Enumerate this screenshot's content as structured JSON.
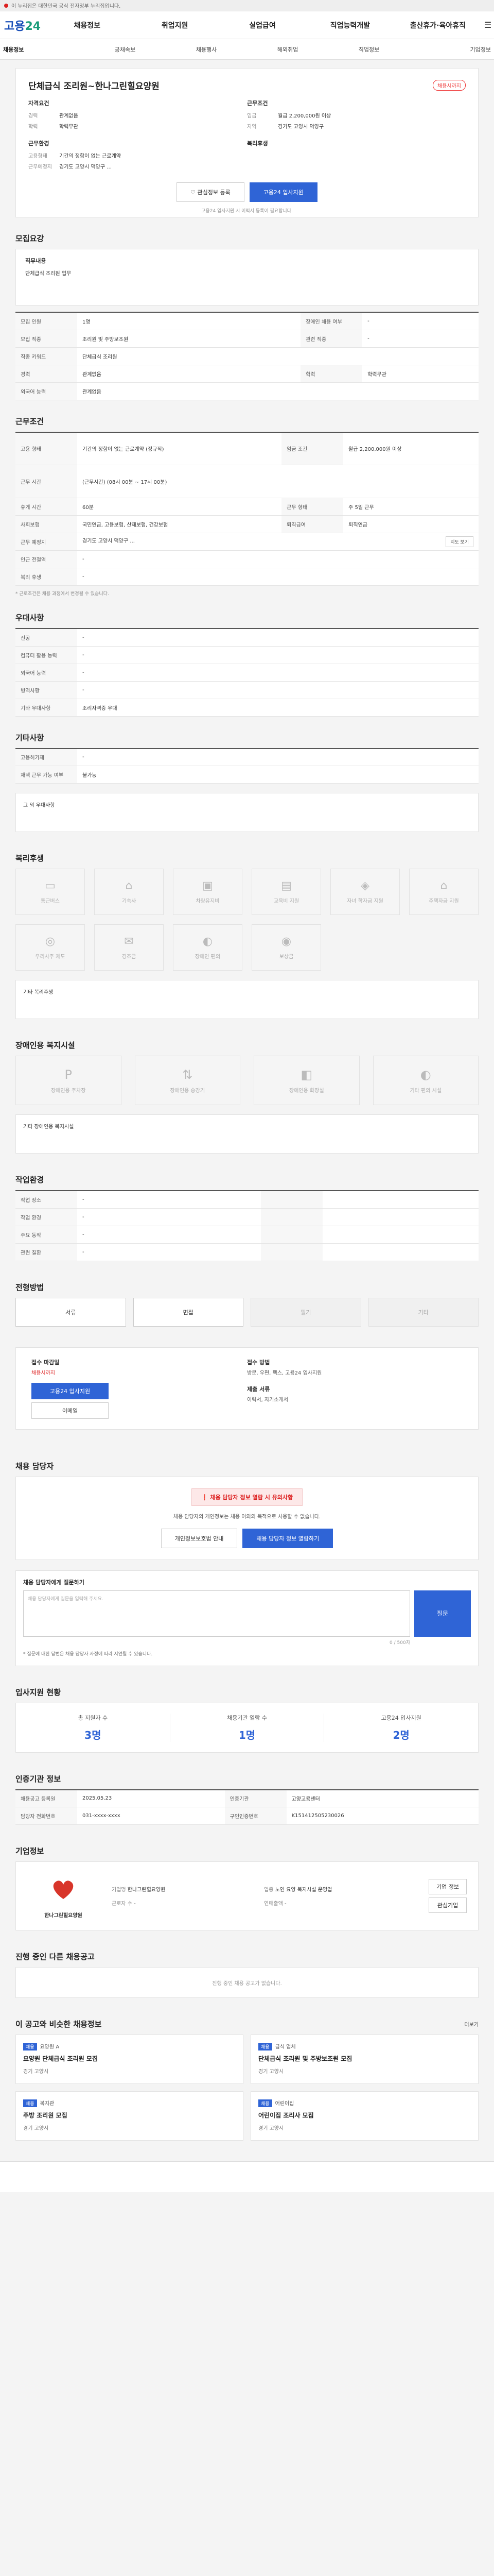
{
  "topbar": {
    "text": "이 누리집은 대한민국 공식 전자정부 누리집입니다."
  },
  "header": {
    "logo_main": "고용",
    "logo_sub": "24",
    "gnb": [
      "채용정보",
      "취업지원",
      "실업급여",
      "직업능력개발",
      "출산휴가·육아휴직"
    ]
  },
  "subnav": [
    "채용정보",
    "공채속보",
    "채용행사",
    "해외취업",
    "직업정보",
    "기업정보"
  ],
  "summary": {
    "title": "단체급식 조리원~한나그린힐요양원",
    "badge": "채용시까지",
    "left_group": "자격요건",
    "left": [
      {
        "k": "경력",
        "v": "관계없음"
      },
      {
        "k": "학력",
        "v": "학력무관"
      }
    ],
    "left_group2": "근무환경",
    "left2": [
      {
        "k": "고용형태",
        "v": "기간의 정함이 없는 근로계약"
      },
      {
        "k": "근무예정지",
        "v": "경기도 고양시 덕양구 ..."
      }
    ],
    "right_group": "근무조건",
    "right": [
      {
        "k": "임금",
        "v": "월급 2,200,000원 이상"
      },
      {
        "k": "지역",
        "v": "경기도 고양시 덕양구"
      }
    ],
    "right_group2": "복리후생",
    "btn_scrap": "관심정보 등록",
    "btn_apply": "고용24 입사지원",
    "note": "고용24 입사지원 시 이력서 등록이 필요합니다."
  },
  "recruit": {
    "title": "모집요강",
    "duty_label": "직무내용",
    "duty": "단체급식 조리원 업무",
    "rows": [
      [
        "모집 인원",
        "1명",
        "장애인 채용 여부",
        "-"
      ],
      [
        "모집 직종",
        "조리원 및 주방보조원",
        "관련 직종",
        "-"
      ],
      [
        "직종 키워드",
        "단체급식 조리원",
        "",
        ""
      ],
      [
        "경력",
        "관계없음",
        "학력",
        "학력무관"
      ],
      [
        "외국어 능력",
        "관계없음",
        "",
        ""
      ]
    ]
  },
  "work": {
    "title": "근무조건",
    "rows": [
      [
        "고용 형태",
        "기간의 정함이 없는 근로계약 (정규직)",
        "임금 조건",
        "월급 2,200,000원 이상"
      ],
      [
        "",
        "",
        "",
        ""
      ],
      [
        "근무 시간",
        "(근무시간) (08시 00분 ~ 17시 00분)",
        "",
        ""
      ],
      [
        "휴게 시간",
        "60분",
        "근무 형태",
        "주 5일 근무"
      ],
      [
        "사회보험",
        "국민연금, 고용보험, 산재보험, 건강보험",
        "퇴직급여",
        "퇴직연금"
      ],
      [
        "근무 예정지",
        "경기도 고양시 덕양구 ...",
        "",
        ""
      ],
      [
        "인근 전철역",
        "-",
        "",
        ""
      ],
      [
        "복리 후생",
        "-",
        "",
        ""
      ]
    ],
    "map_btn": "지도 보기",
    "footnote": "* 근로조건은 채용 과정에서 변경될 수 있습니다."
  },
  "prefs": {
    "title": "우대사항",
    "rows": [
      [
        "전공",
        "-"
      ],
      [
        "컴퓨터 활용 능력",
        "-"
      ],
      [
        "외국어 능력",
        "-"
      ],
      [
        "병역사항",
        "-"
      ],
      [
        "기타 우대사항",
        "조리자격증 우대"
      ]
    ]
  },
  "etc": {
    "title": "기타사항",
    "rows": [
      [
        "고용허가제",
        "-"
      ],
      [
        "재택 근무 가능 여부",
        "불가능"
      ]
    ],
    "empty": "그 외 우대사항"
  },
  "welfare": {
    "title": "복리후생",
    "items": [
      "통근버스",
      "기숙사",
      "차량유지비",
      "교육비 지원",
      "자녀 학자금 지원",
      "주택자금 지원",
      "우리사주 제도",
      "경조금",
      "장애인 편의",
      "보상금"
    ],
    "empty": "기타 복리후생"
  },
  "disab": {
    "title": "장애인용 복지시설",
    "items": [
      "장애인용 주차장",
      "장애인용 승강기",
      "장애인용 화장실",
      "기타 편의 시설"
    ],
    "empty": "기타 장애인용 복지시설"
  },
  "env": {
    "title": "작업환경",
    "rows": [
      [
        "작업 장소",
        "-",
        "",
        ""
      ],
      [
        "작업 환경",
        "-",
        "",
        ""
      ],
      [
        "주요 동작",
        "-",
        "",
        ""
      ],
      [
        "관련 질환",
        "-",
        "",
        ""
      ]
    ]
  },
  "process": {
    "title": "전형방법",
    "steps": [
      "서류",
      "면접",
      "필기",
      "기타"
    ]
  },
  "apply": {
    "label": "접수 마감일",
    "deadline": "채용시까지",
    "btn1": "고용24 입사지원",
    "btn2": "이메일",
    "label2": "접수 방법",
    "methods": "방문, 우편, 팩스, 고용24 입사지원",
    "label3": "제출 서류",
    "docs": "이력서, 자기소개서"
  },
  "contact": {
    "title": "채용 담당자",
    "warn": "채용 담당자 정보 열람 시 유의사항",
    "text": "채용 담당자의 개인정보는 채용 이외의 목적으로 사용할 수 없습니다.",
    "btn1": "개인정보보호법 안내",
    "btn2": "채용 담당자 정보 열람하기"
  },
  "qa": {
    "title": "채용 담당자에게 질문하기",
    "placeholder": "채용 담당자에게 질문을 입력해 주세요.",
    "btn": "질문",
    "counter": "0 / 500자",
    "notes": "* 질문에 대한 답변은 채용 담당자 사정에 따라 지연될 수 있습니다."
  },
  "stats": {
    "title": "입사지원 현황",
    "items": [
      {
        "label": "총 지원자 수",
        "value": "3명"
      },
      {
        "label": "채용기관 열람 수",
        "value": "1명"
      },
      {
        "label": "고용24 입사지원",
        "value": "2명"
      }
    ]
  },
  "agency": {
    "title": "인증기관 정보",
    "rows": [
      [
        "채용공고 등록일",
        "2025.05.23",
        "인증기관",
        "고양고용센터"
      ],
      [
        "담당자 전화번호",
        "031-xxxx-xxxx",
        "구인인증번호",
        "K151412505230026"
      ]
    ]
  },
  "company": {
    "title": "기업정보",
    "name": "한나그린힐요양원",
    "info": [
      [
        "기업명",
        "한나그린힐요양원"
      ],
      [
        "업종",
        "노인 요양 복지시설 운영업"
      ],
      [
        "근로자 수",
        "-"
      ],
      [
        "연매출액",
        "-"
      ]
    ],
    "btn1": "기업 정보",
    "btn2": "관심기업"
  },
  "related": {
    "title": "진행 중인 다른 채용공고",
    "empty": "진행 중인 채용 공고가 없습니다."
  },
  "recommend": {
    "title": "이 공고와 비슷한 채용정보",
    "more": "더보기",
    "cards": [
      {
        "tag": "채용",
        "company": "요양원 A",
        "title": "요양원 단체급식 조리원 모집",
        "loc": "경기 고양시"
      },
      {
        "tag": "채용",
        "company": "급식 업체",
        "title": "단체급식 조리원 및 주방보조원 모집",
        "loc": "경기 고양시"
      },
      {
        "tag": "채용",
        "company": "복지관",
        "title": "주방 조리원 모집",
        "loc": "경기 고양시"
      },
      {
        "tag": "채용",
        "company": "어린이집",
        "title": "어린이집 조리사 모집",
        "loc": "경기 고양시"
      }
    ]
  }
}
